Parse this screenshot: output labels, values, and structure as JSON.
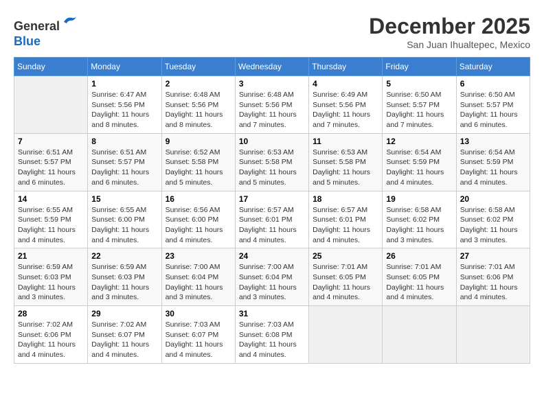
{
  "header": {
    "logo_line1": "General",
    "logo_line2": "Blue",
    "month": "December 2025",
    "location": "San Juan Ihualtepec, Mexico"
  },
  "weekdays": [
    "Sunday",
    "Monday",
    "Tuesday",
    "Wednesday",
    "Thursday",
    "Friday",
    "Saturday"
  ],
  "weeks": [
    [
      {
        "day": "",
        "info": ""
      },
      {
        "day": "1",
        "info": "Sunrise: 6:47 AM\nSunset: 5:56 PM\nDaylight: 11 hours\nand 8 minutes."
      },
      {
        "day": "2",
        "info": "Sunrise: 6:48 AM\nSunset: 5:56 PM\nDaylight: 11 hours\nand 8 minutes."
      },
      {
        "day": "3",
        "info": "Sunrise: 6:48 AM\nSunset: 5:56 PM\nDaylight: 11 hours\nand 7 minutes."
      },
      {
        "day": "4",
        "info": "Sunrise: 6:49 AM\nSunset: 5:56 PM\nDaylight: 11 hours\nand 7 minutes."
      },
      {
        "day": "5",
        "info": "Sunrise: 6:50 AM\nSunset: 5:57 PM\nDaylight: 11 hours\nand 7 minutes."
      },
      {
        "day": "6",
        "info": "Sunrise: 6:50 AM\nSunset: 5:57 PM\nDaylight: 11 hours\nand 6 minutes."
      }
    ],
    [
      {
        "day": "7",
        "info": "Sunrise: 6:51 AM\nSunset: 5:57 PM\nDaylight: 11 hours\nand 6 minutes."
      },
      {
        "day": "8",
        "info": "Sunrise: 6:51 AM\nSunset: 5:57 PM\nDaylight: 11 hours\nand 6 minutes."
      },
      {
        "day": "9",
        "info": "Sunrise: 6:52 AM\nSunset: 5:58 PM\nDaylight: 11 hours\nand 5 minutes."
      },
      {
        "day": "10",
        "info": "Sunrise: 6:53 AM\nSunset: 5:58 PM\nDaylight: 11 hours\nand 5 minutes."
      },
      {
        "day": "11",
        "info": "Sunrise: 6:53 AM\nSunset: 5:58 PM\nDaylight: 11 hours\nand 5 minutes."
      },
      {
        "day": "12",
        "info": "Sunrise: 6:54 AM\nSunset: 5:59 PM\nDaylight: 11 hours\nand 4 minutes."
      },
      {
        "day": "13",
        "info": "Sunrise: 6:54 AM\nSunset: 5:59 PM\nDaylight: 11 hours\nand 4 minutes."
      }
    ],
    [
      {
        "day": "14",
        "info": "Sunrise: 6:55 AM\nSunset: 5:59 PM\nDaylight: 11 hours\nand 4 minutes."
      },
      {
        "day": "15",
        "info": "Sunrise: 6:55 AM\nSunset: 6:00 PM\nDaylight: 11 hours\nand 4 minutes."
      },
      {
        "day": "16",
        "info": "Sunrise: 6:56 AM\nSunset: 6:00 PM\nDaylight: 11 hours\nand 4 minutes."
      },
      {
        "day": "17",
        "info": "Sunrise: 6:57 AM\nSunset: 6:01 PM\nDaylight: 11 hours\nand 4 minutes."
      },
      {
        "day": "18",
        "info": "Sunrise: 6:57 AM\nSunset: 6:01 PM\nDaylight: 11 hours\nand 4 minutes."
      },
      {
        "day": "19",
        "info": "Sunrise: 6:58 AM\nSunset: 6:02 PM\nDaylight: 11 hours\nand 3 minutes."
      },
      {
        "day": "20",
        "info": "Sunrise: 6:58 AM\nSunset: 6:02 PM\nDaylight: 11 hours\nand 3 minutes."
      }
    ],
    [
      {
        "day": "21",
        "info": "Sunrise: 6:59 AM\nSunset: 6:03 PM\nDaylight: 11 hours\nand 3 minutes."
      },
      {
        "day": "22",
        "info": "Sunrise: 6:59 AM\nSunset: 6:03 PM\nDaylight: 11 hours\nand 3 minutes."
      },
      {
        "day": "23",
        "info": "Sunrise: 7:00 AM\nSunset: 6:04 PM\nDaylight: 11 hours\nand 3 minutes."
      },
      {
        "day": "24",
        "info": "Sunrise: 7:00 AM\nSunset: 6:04 PM\nDaylight: 11 hours\nand 3 minutes."
      },
      {
        "day": "25",
        "info": "Sunrise: 7:01 AM\nSunset: 6:05 PM\nDaylight: 11 hours\nand 4 minutes."
      },
      {
        "day": "26",
        "info": "Sunrise: 7:01 AM\nSunset: 6:05 PM\nDaylight: 11 hours\nand 4 minutes."
      },
      {
        "day": "27",
        "info": "Sunrise: 7:01 AM\nSunset: 6:06 PM\nDaylight: 11 hours\nand 4 minutes."
      }
    ],
    [
      {
        "day": "28",
        "info": "Sunrise: 7:02 AM\nSunset: 6:06 PM\nDaylight: 11 hours\nand 4 minutes."
      },
      {
        "day": "29",
        "info": "Sunrise: 7:02 AM\nSunset: 6:07 PM\nDaylight: 11 hours\nand 4 minutes."
      },
      {
        "day": "30",
        "info": "Sunrise: 7:03 AM\nSunset: 6:07 PM\nDaylight: 11 hours\nand 4 minutes."
      },
      {
        "day": "31",
        "info": "Sunrise: 7:03 AM\nSunset: 6:08 PM\nDaylight: 11 hours\nand 4 minutes."
      },
      {
        "day": "",
        "info": ""
      },
      {
        "day": "",
        "info": ""
      },
      {
        "day": "",
        "info": ""
      }
    ]
  ]
}
